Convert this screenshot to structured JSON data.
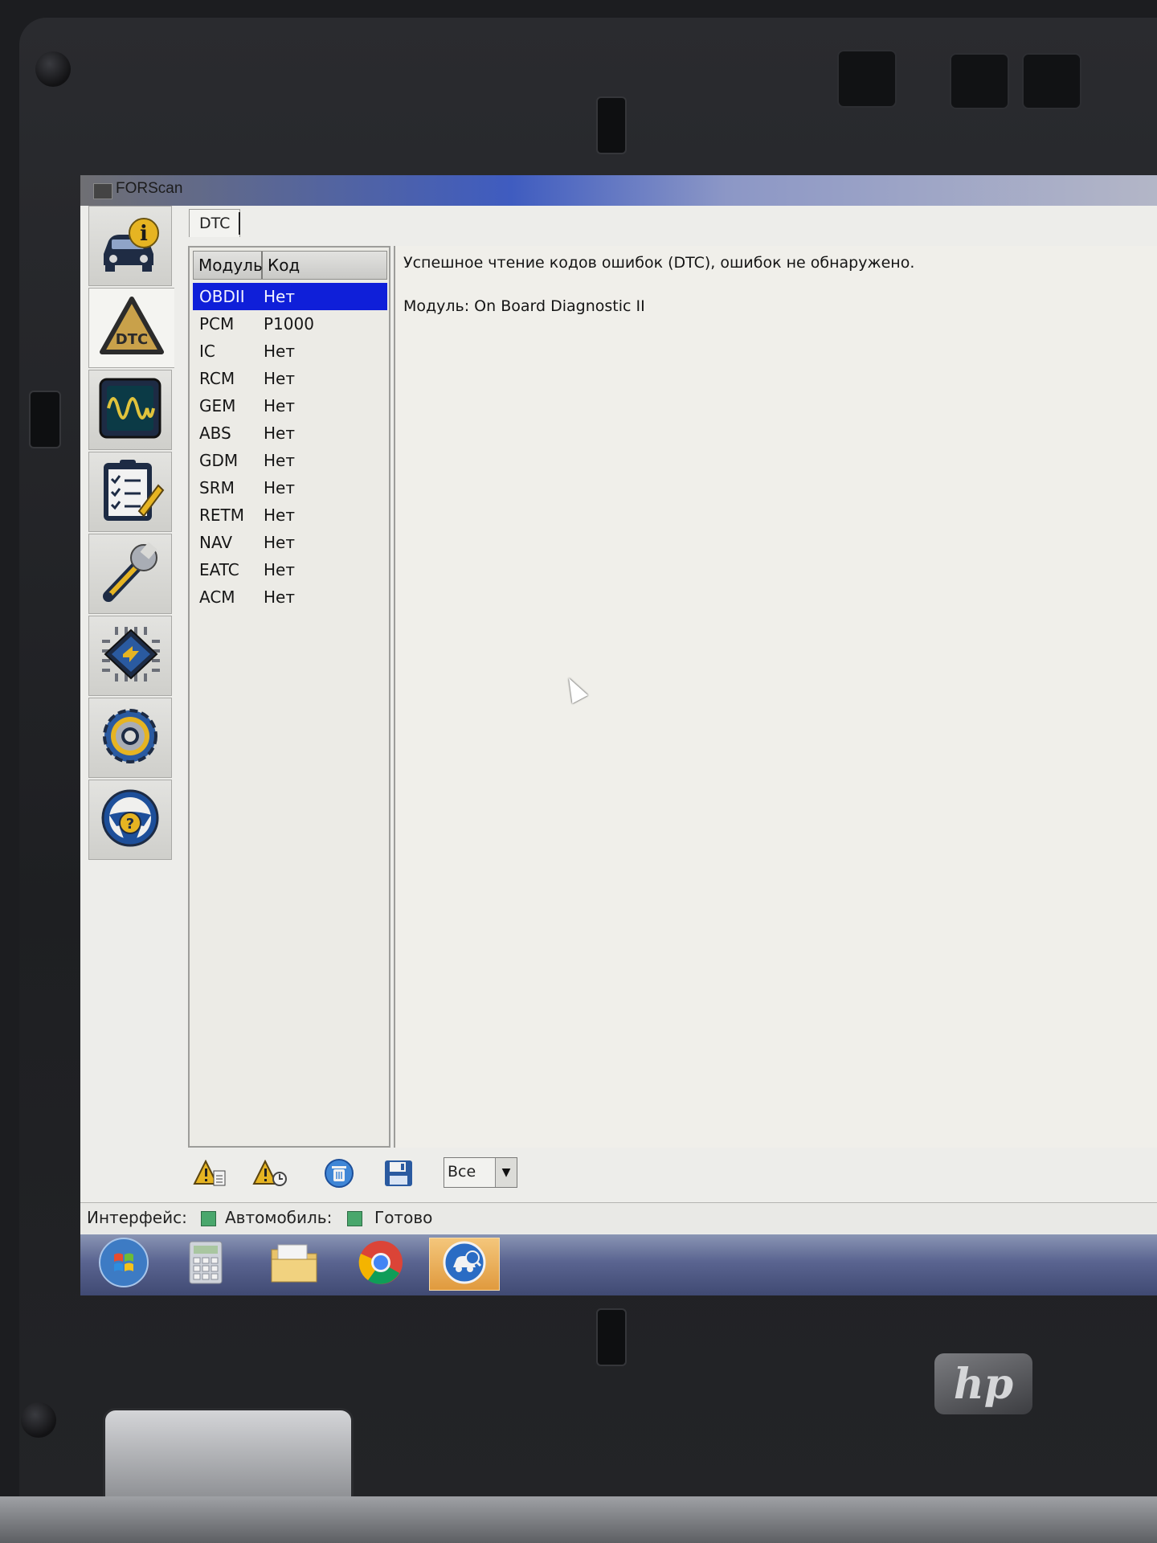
{
  "window": {
    "title": "FORScan"
  },
  "sidebar": {
    "items": [
      {
        "name": "vehicle-info",
        "icon": "car-info-icon"
      },
      {
        "name": "dtc",
        "icon": "dtc-warning-icon",
        "icon_text": "DTC",
        "active": true
      },
      {
        "name": "oscilloscope",
        "icon": "oscilloscope-icon"
      },
      {
        "name": "tests",
        "icon": "checklist-icon"
      },
      {
        "name": "service",
        "icon": "wrench-icon"
      },
      {
        "name": "configuration",
        "icon": "chip-icon"
      },
      {
        "name": "settings",
        "icon": "gear-icon"
      },
      {
        "name": "help",
        "icon": "steering-help-icon"
      }
    ]
  },
  "tabs": [
    {
      "label": "DTC"
    }
  ],
  "dtc_table": {
    "columns": [
      "Модуль",
      "Код"
    ],
    "rows": [
      {
        "module": "OBDII",
        "code": "Нет",
        "selected": true
      },
      {
        "module": "PCM",
        "code": "P1000"
      },
      {
        "module": "IC",
        "code": "Нет"
      },
      {
        "module": "RCM",
        "code": "Нет"
      },
      {
        "module": "GEM",
        "code": "Нет"
      },
      {
        "module": "ABS",
        "code": "Нет"
      },
      {
        "module": "GDM",
        "code": "Нет"
      },
      {
        "module": "SRM",
        "code": "Нет"
      },
      {
        "module": "RETM",
        "code": "Нет"
      },
      {
        "module": "NAV",
        "code": "Нет"
      },
      {
        "module": "EATC",
        "code": "Нет"
      },
      {
        "module": "ACM",
        "code": "Нет"
      }
    ]
  },
  "message": {
    "line1": "Успешное чтение кодов ошибок (DTC), ошибок не обнаружено.",
    "line2": "Модуль: On Board Diagnostic II"
  },
  "toolbar": {
    "buttons": [
      "read-dtc-icon",
      "read-dtc-all-icon",
      "clear-dtc-icon",
      "save-icon"
    ],
    "filter_value": "Все"
  },
  "status": {
    "interface_label": "Интерфейс:",
    "vehicle_label": "Автомобиль:",
    "state": "Готово",
    "led_color": "#49a76c"
  },
  "taskbar": {
    "items": [
      "start-orb-icon",
      "calculator-icon",
      "file-explorer-icon",
      "chrome-icon",
      "forscan-icon"
    ],
    "active": "forscan-icon"
  },
  "device": {
    "logo_text": "hp"
  }
}
